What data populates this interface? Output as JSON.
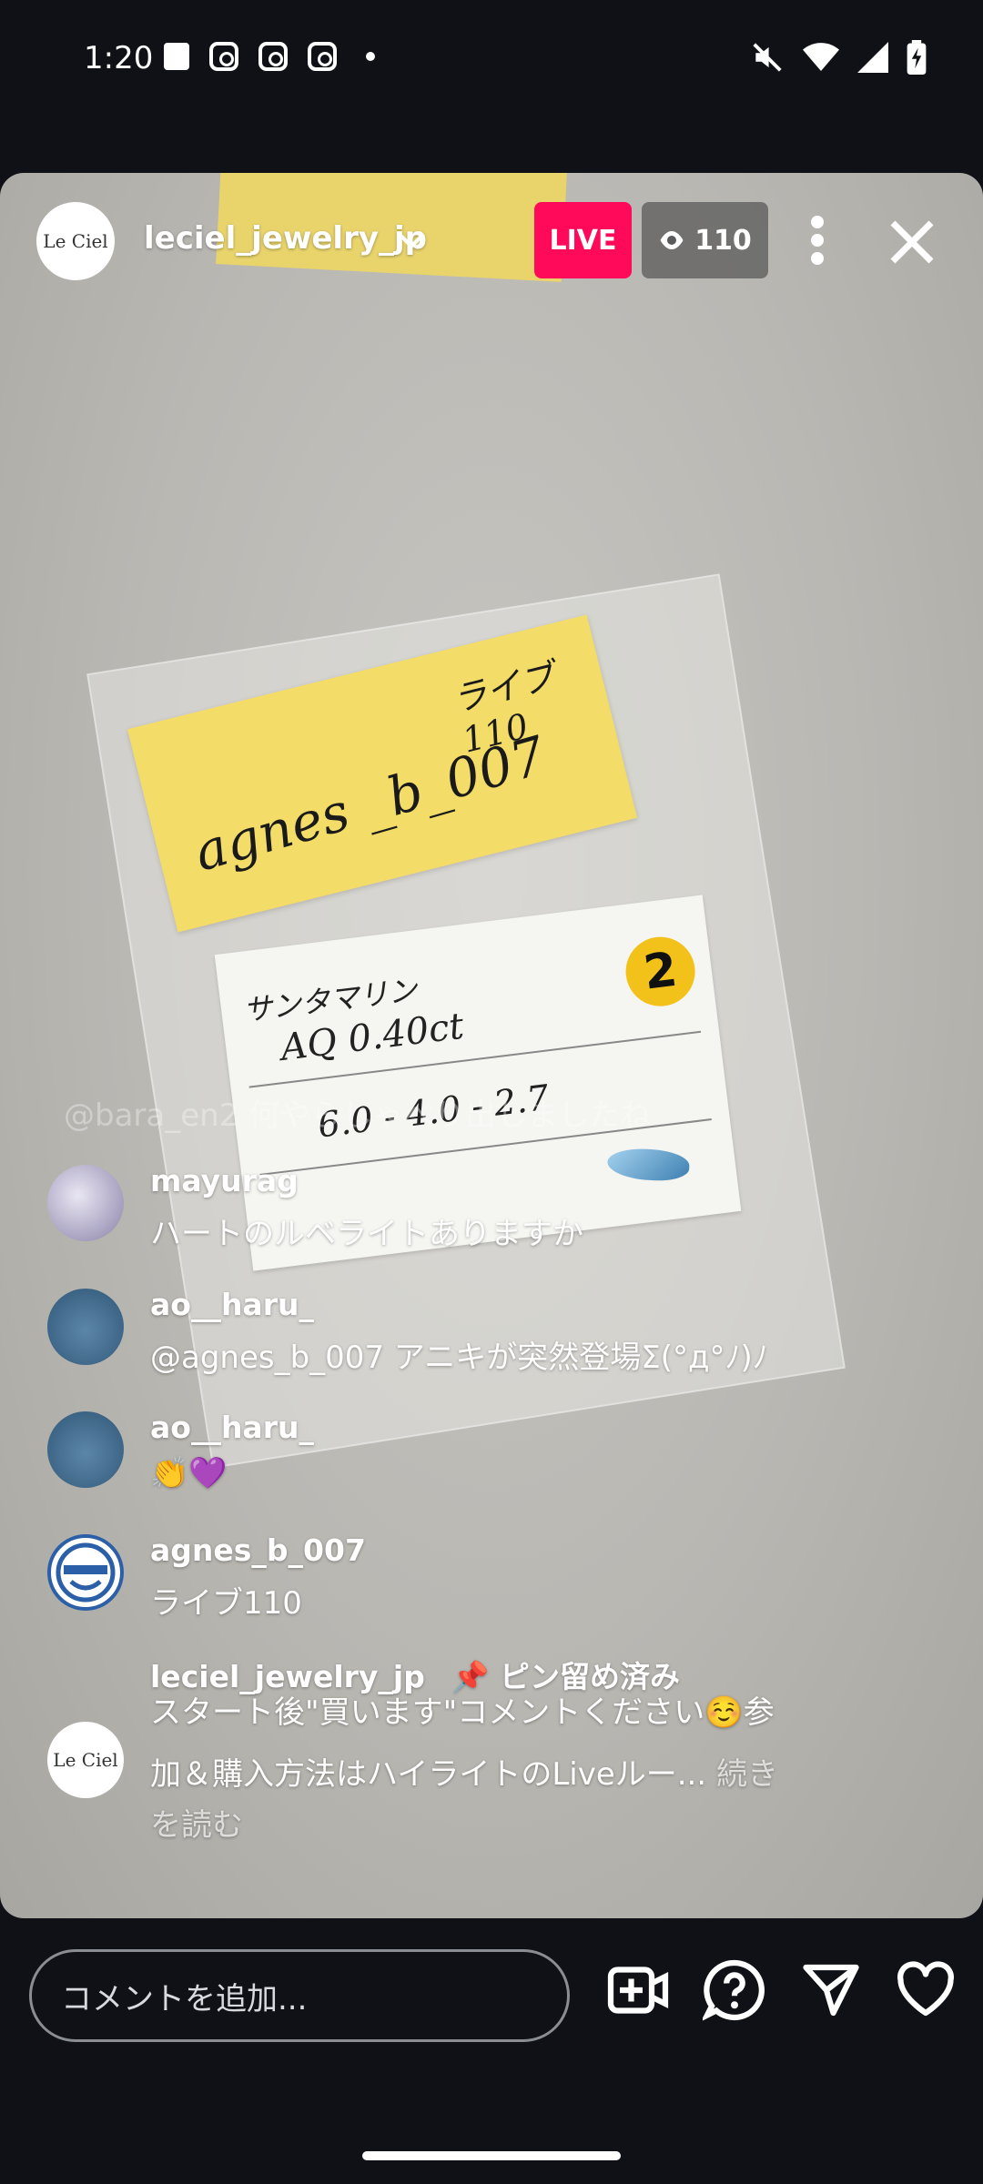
{
  "status_bar": {
    "time": "1:20",
    "left_icons": [
      "shopping-bag-icon",
      "instagram-icon",
      "instagram-icon",
      "instagram-icon",
      "notification-dot-icon"
    ],
    "right_icons": [
      "mute-icon",
      "wifi-icon",
      "signal-icon",
      "battery-charging-icon"
    ]
  },
  "header": {
    "account_name": "leciel_jewelry_jp",
    "avatar_text": "Le Ciel",
    "live_label": "LIVE",
    "viewer_count": "110"
  },
  "video": {
    "sticky_note_main": "agnes _b_007",
    "sticky_note_sub": "ライブ110",
    "card_line1": "サンタマリン",
    "card_line2": "AQ  0.40ct",
    "card_line3": "6.0 - 4.0 - 2.7",
    "card_badge": "2"
  },
  "comments": {
    "faded": "@bara_en2 何やらしゃべり出しましたね",
    "items": [
      {
        "user": "mayurag",
        "text": "ハートのルベライトありますか"
      },
      {
        "user": "ao__haru_",
        "text": "@agnes_b_007 アニキが突然登場Σ(°д°ﾉ)ﾉ"
      },
      {
        "user": "ao__haru_",
        "text": "👏💜"
      },
      {
        "user": "agnes_b_007",
        "text": "ライブ110"
      }
    ],
    "pinned": {
      "user": "leciel_jewelry_jp",
      "pin_label": "ピン留め済み",
      "line1": "スタート後\"買います\"コメントください☺️参",
      "line2": "加＆購入方法はハイライトのLiveルー...",
      "more": " 続き",
      "line3": "を読む"
    }
  },
  "bottom_bar": {
    "comment_placeholder": "コメントを追加...",
    "icons": [
      "add-video-icon",
      "question-icon",
      "send-icon",
      "heart-icon"
    ]
  },
  "colors": {
    "live_badge": "#ff0a5a",
    "background": "#0f1116"
  }
}
